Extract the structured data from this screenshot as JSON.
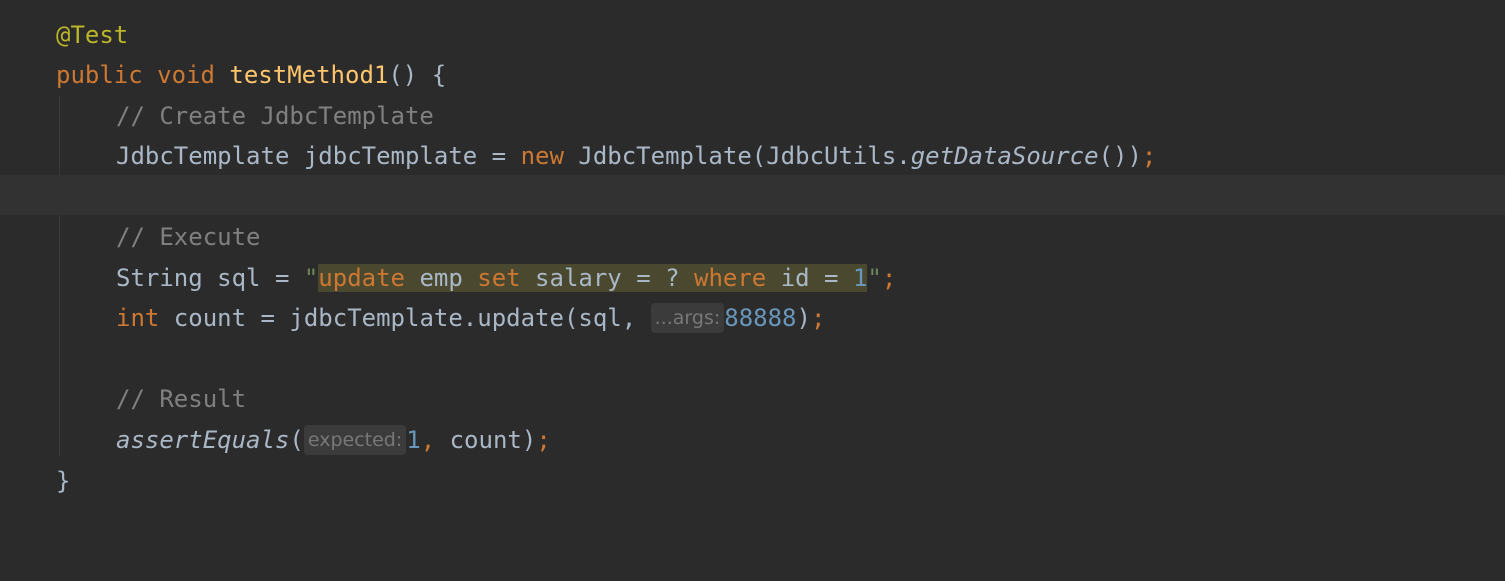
{
  "code": {
    "annotation": "@Test",
    "signature": {
      "modifier": "public",
      "return_type": "void",
      "method_name": "testMethod1",
      "params_open": "() {"
    },
    "comment_create": "// Create JdbcTemplate",
    "line_template": {
      "type": "JdbcTemplate",
      "var": " jdbcTemplate = ",
      "new_kw": "new",
      "ctor": " JdbcTemplate(JdbcUtils.",
      "static_call": "getDataSource",
      "close": "())",
      "semicolon": ";"
    },
    "comment_execute": "// Execute",
    "line_sql": {
      "prefix": "String sql = ",
      "quote_open": "\"",
      "kw_update": "update",
      "emp": " emp ",
      "kw_set": "set",
      "salary": " salary = ? ",
      "kw_where": "where",
      "id": " id = ",
      "num": "1",
      "quote_close": "\"",
      "semicolon": ";"
    },
    "line_update": {
      "type_kw": "int",
      "rest": " count = jdbcTemplate.update(sql, ",
      "hint": "...args:",
      "value": "88888",
      "close": ")",
      "semicolon": ";"
    },
    "comment_result": "// Result",
    "line_assert": {
      "method": "assertEquals",
      "open": "(",
      "hint": "expected:",
      "value": "1",
      "comma": ",",
      "rest": " count)",
      "semicolon": ";"
    },
    "closing_brace": "}"
  },
  "colors": {
    "background": "#2b2b2b",
    "current_line": "#323232",
    "keyword": "#cc7832",
    "annotation": "#bbb529",
    "function": "#ffc66d",
    "comment": "#808080",
    "number": "#6897bb",
    "text": "#a9b7c6",
    "sql_background": "#4a4930"
  }
}
